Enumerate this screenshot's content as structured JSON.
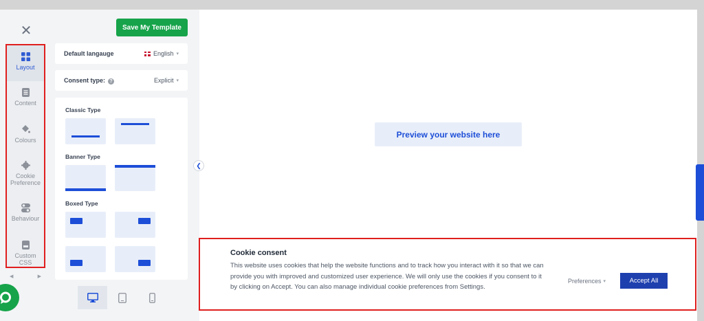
{
  "editor": {
    "close_icon": "close-icon",
    "save_label": "Save My Template",
    "nav": [
      {
        "label": "Layout",
        "icon": "grid-icon"
      },
      {
        "label": "Content",
        "icon": "document-icon"
      },
      {
        "label": "Colours",
        "icon": "paint-bucket-icon"
      },
      {
        "label": "Cookie Preference",
        "icon": "gear-icon"
      },
      {
        "label": "Behaviour",
        "icon": "toggle-icon"
      },
      {
        "label": "Custom CSS",
        "icon": "css-file-icon"
      }
    ],
    "default_language": {
      "label": "Default langauge",
      "value": "English"
    },
    "consent_type": {
      "label": "Consent type:",
      "value": "Explicit"
    },
    "sections": {
      "classic": "Classic Type",
      "banner": "Banner Type",
      "boxed": "Boxed Type"
    },
    "devices": [
      "desktop-icon",
      "tablet-icon",
      "mobile-icon"
    ]
  },
  "preview": {
    "button_label": "Preview your website here"
  },
  "cookie": {
    "title": "Cookie consent",
    "text": "This website uses cookies that help the website functions and to track how you interact with it so that we can provide you with improved and customized user experience. We will only use the cookies if you consent to it by clicking on Accept. You can also manage individual cookie preferences from Settings.",
    "preferences_label": "Preferences",
    "accept_label": "Accept All"
  },
  "colors": {
    "accent": "#1d4ed8",
    "save": "#16a34a",
    "highlight": "#e01e1e"
  }
}
